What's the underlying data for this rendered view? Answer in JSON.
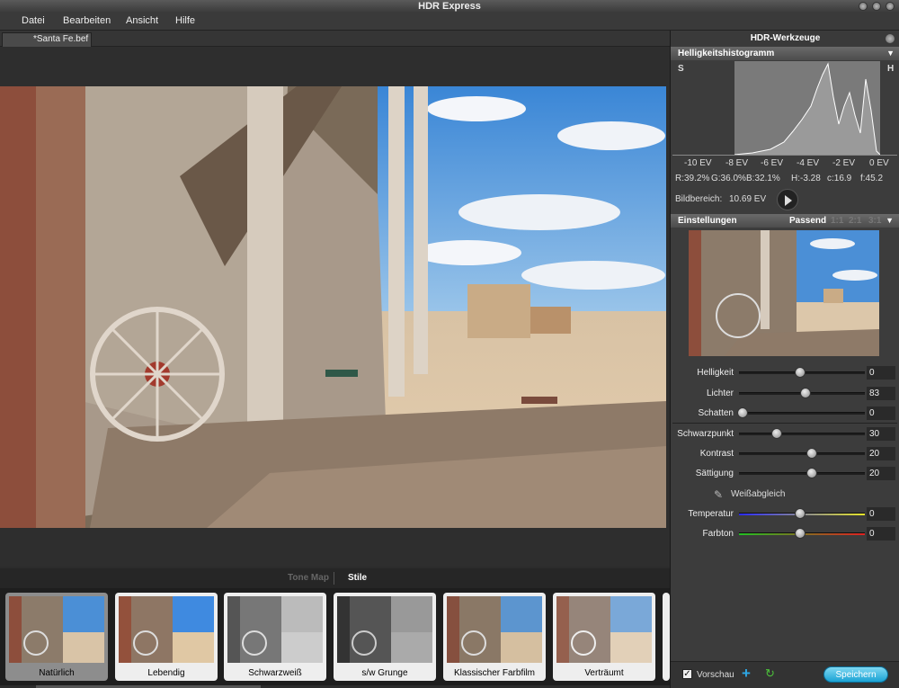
{
  "window": {
    "title": "HDR Express"
  },
  "menu": [
    "Datei",
    "Bearbeiten",
    "Ansicht",
    "Hilfe"
  ],
  "document": {
    "tab_label": "*Santa Fe.bef"
  },
  "strip": {
    "tabs": [
      "Tone Map",
      "Stile"
    ],
    "active_tab": "Stile",
    "presets": [
      "Natürlich",
      "Lebendig",
      "Schwarzweiß",
      "s/w Grunge",
      "Klassischer Farbfilm",
      "Verträumt"
    ],
    "selected": "Natürlich"
  },
  "panel": {
    "title": "HDR-Werkzeuge",
    "histogram": {
      "title": "Helligkeitshistogramm",
      "left_marker": "S",
      "right_marker": "H",
      "ev_labels": [
        "-10 EV",
        "-8 EV",
        "-6 EV",
        "-4 EV",
        "-2 EV",
        "0 EV"
      ],
      "stats": [
        "R:39.2%",
        "G:36.0%",
        "B:32.1%",
        "H:-3.28",
        "c:16.9",
        "f:45.2"
      ],
      "range_label": "Bildbereich:",
      "range_value": "10.69 EV"
    },
    "settings": {
      "title": "Einstellungen",
      "zoom_options": [
        "Passend",
        "1:1",
        "2:1",
        "3:1"
      ],
      "sliders": [
        {
          "label": "Helligkeit",
          "value": "0",
          "level": 0.5
        },
        {
          "label": "Lichter",
          "value": "83",
          "level": 0.55
        },
        {
          "label": "Schatten",
          "value": "0",
          "level": 0.0
        },
        {
          "label": "Schwarzpunkt",
          "value": "30",
          "level": 0.3
        },
        {
          "label": "Kontrast",
          "value": "20",
          "level": 0.6
        },
        {
          "label": "Sättigung",
          "value": "20",
          "level": 0.6
        }
      ],
      "white_balance_label": "Weißabgleich",
      "color_sliders": [
        {
          "label": "Temperatur",
          "value": "0",
          "level": 0.5
        },
        {
          "label": "Farbton",
          "value": "0",
          "level": 0.5
        }
      ]
    },
    "footer": {
      "preview_label": "Vorschau",
      "preview_checked": true,
      "save_label": "Speichern"
    }
  },
  "colors": {
    "accent": "#1aa2d4",
    "panel_bg": "#3c3c3c",
    "header": "#5a5a5a"
  }
}
